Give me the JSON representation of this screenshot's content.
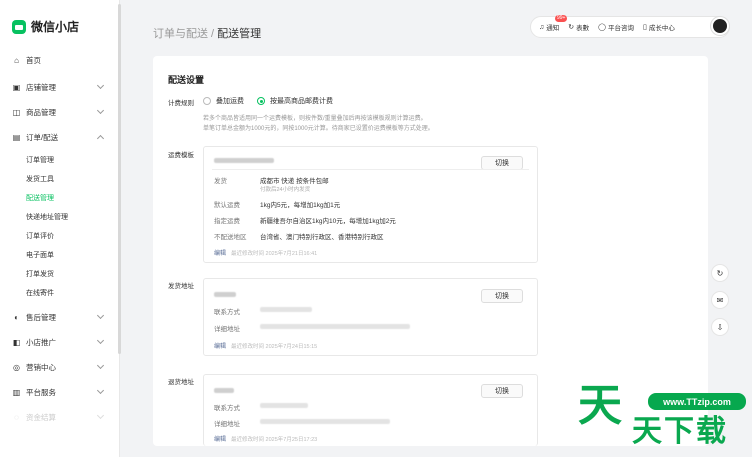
{
  "brand": {
    "name": "微信小店",
    "color": "#07c160"
  },
  "nav": {
    "home": "首页",
    "shop": "店铺管理",
    "goods": "商品管理",
    "orders": "订单/配送",
    "sub": [
      "订单管理",
      "发货工具",
      "配送管理",
      "快递地址管理",
      "订单评价",
      "电子面单",
      "打单发货",
      "在线寄件"
    ],
    "after_sale": "售后管理",
    "promo": "小店推广",
    "marketing": "营销中心",
    "platform": "平台服务",
    "faded": "资金结算"
  },
  "breadcrumb": {
    "parent": "订单与配送",
    "sep": " / ",
    "current": "配送管理"
  },
  "topbar": {
    "notify": "通知",
    "notify_badge": "99+",
    "table": "表數",
    "consult": "平台咨询",
    "growth": "成长中心"
  },
  "settings": {
    "title": "配送设置",
    "rule_label": "计费规则",
    "opt1": "叠加运费",
    "opt2": "按最高商品邮费计费",
    "hint1": "若多个商品皆适用同一个运费模板，则按件数/重量叠加后再按该模板规则计算运费。",
    "hint2": "单笔订单总金额为1000元的，同按1000元计算。待商家已设置价运费模板等方式处理。"
  },
  "template": {
    "label": "运费模板",
    "switch": "切换",
    "ship_k": "发货",
    "ship_v": "成都市 快递 按条件包邮",
    "ship_sub": "付款后24小时内发货",
    "default_k": "默认运费",
    "default_v": "1kg内5元，每增加1kg加1元",
    "special_k": "指定运费",
    "special_v": "新疆维吾尔自治区1kg内10元，每增加1kg加2元",
    "noship_k": "不配送地区",
    "noship_v": "台湾省、澳门特别行政区、香港特别行政区",
    "edit": "编辑",
    "edit_time": "最近修改时间 2025年7月21日16:41"
  },
  "ship_addr": {
    "label": "发货地址",
    "switch": "切换",
    "contact_k": "联系方式",
    "detail_k": "详细地址",
    "edit": "编辑",
    "edit_time": "最近修改时间 2025年7月24日15:15"
  },
  "return_addr": {
    "label": "退货地址",
    "switch": "切换",
    "contact_k": "联系方式",
    "detail_k": "详细地址",
    "edit": "编辑",
    "edit_time": "最近修改时间 2025年7月25日17:23"
  },
  "watermark": {
    "url": "www.TTzip.com",
    "big": "天",
    "text": "天下载"
  }
}
